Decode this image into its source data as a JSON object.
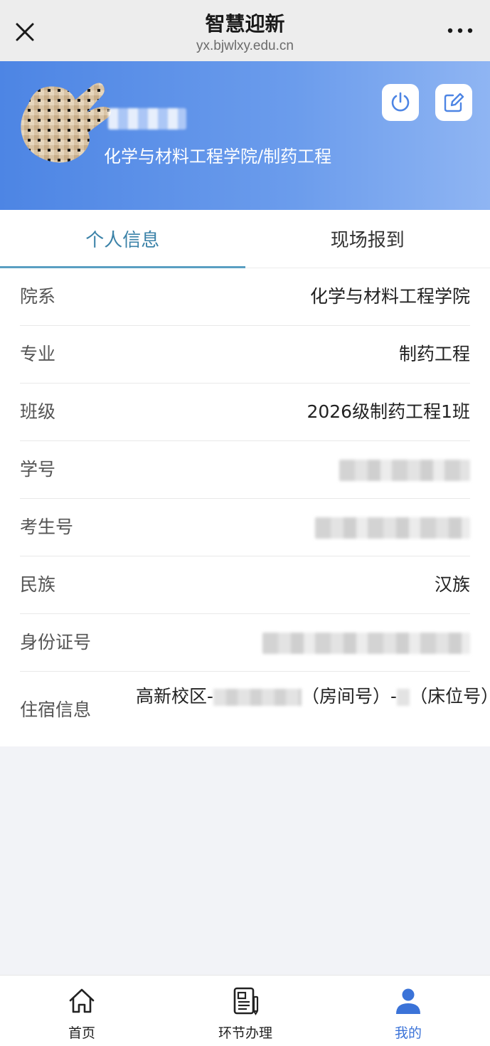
{
  "topbar": {
    "title": "智慧迎新",
    "url": "yx.bjwlxy.edu.cn",
    "close_icon": "close-icon",
    "more_icon": "more-icon"
  },
  "hero": {
    "subtitle": "化学与材料工程学院/制药工程",
    "power_icon": "power-icon",
    "edit_icon": "edit-icon",
    "colors": {
      "gradient_start": "#4d85e4",
      "gradient_end": "#8fb5f3"
    }
  },
  "tabs": [
    {
      "label": "个人信息",
      "active": true
    },
    {
      "label": "现场报到",
      "active": false
    }
  ],
  "info": {
    "department": {
      "label": "院系",
      "value": "化学与材料工程学院"
    },
    "major": {
      "label": "专业",
      "value": "制药工程"
    },
    "class": {
      "label": "班级",
      "value": "2026级制药工程1班"
    },
    "student_id": {
      "label": "学号"
    },
    "exam_id": {
      "label": "考生号"
    },
    "ethnicity": {
      "label": "民族",
      "value": "汉族"
    },
    "id_card": {
      "label": "身份证号"
    },
    "dorm": {
      "label": "住宿信息",
      "campus": "高新校区-",
      "room_suffix": "（房间号）-",
      "bed_suffix": "（床位号）"
    }
  },
  "bottom_nav": [
    {
      "label": "首页",
      "icon": "home-icon",
      "active": false
    },
    {
      "label": "环节办理",
      "icon": "document-icon",
      "active": false
    },
    {
      "label": "我的",
      "icon": "user-icon",
      "active": true
    }
  ],
  "accent_color": "#3b73d8"
}
